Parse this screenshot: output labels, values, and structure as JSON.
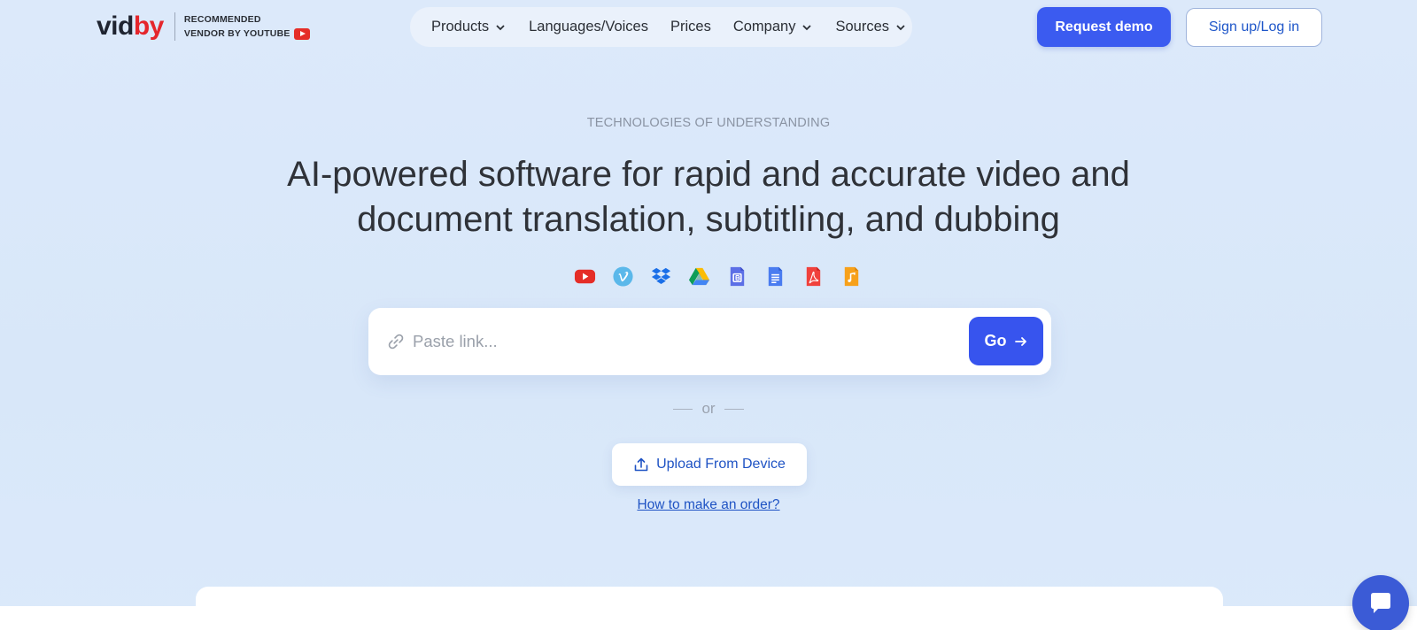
{
  "brand": {
    "name_part1": "vid",
    "name_part2": "by",
    "tagline_line1": "RECOMMENDED",
    "tagline_line2": "VENDOR BY  YOUTUBE"
  },
  "nav": {
    "items": [
      {
        "label": "Products",
        "has_dropdown": true
      },
      {
        "label": "Languages/Voices",
        "has_dropdown": false
      },
      {
        "label": "Prices",
        "has_dropdown": false
      },
      {
        "label": "Company",
        "has_dropdown": true
      },
      {
        "label": "Sources",
        "has_dropdown": true
      }
    ]
  },
  "header": {
    "demo_label": "Request demo",
    "login_label": "Sign up/Log in"
  },
  "hero": {
    "eyebrow": "TECHNOLOGIES OF UNDERSTANDING",
    "headline_line1": "AI-powered software for rapid and accurate video and",
    "headline_line2": "document translation, subtitling, and dubbing",
    "source_icons": [
      "youtube-icon",
      "vimeo-icon",
      "dropbox-icon",
      "google-drive-icon",
      "google-slides-icon",
      "google-docs-icon",
      "pdf-icon",
      "audio-file-icon"
    ]
  },
  "link_form": {
    "placeholder": "Paste link...",
    "go_label": "Go"
  },
  "divider": {
    "or_text": "or"
  },
  "upload": {
    "label": "Upload From Device"
  },
  "howto": {
    "label": "How to make an order?"
  },
  "colors": {
    "accent": "#3b5bf0",
    "brand_red": "#e5262c",
    "link_blue": "#1f53c4",
    "background": "#dce9fa"
  }
}
